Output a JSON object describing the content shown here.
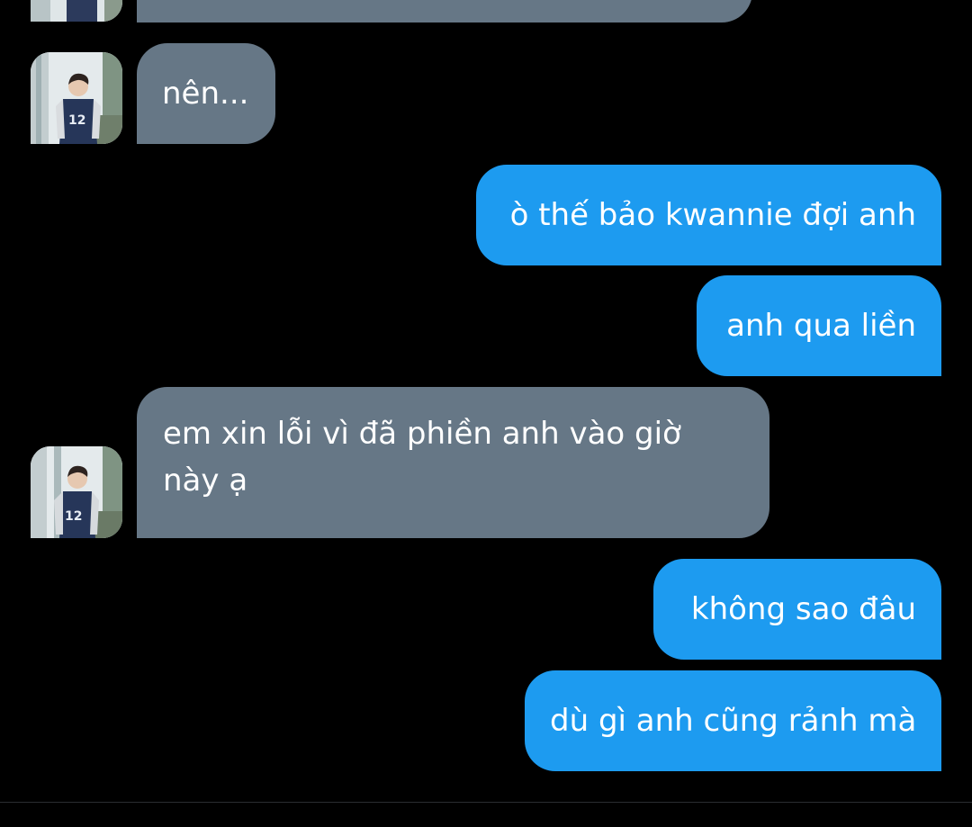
{
  "conversation": {
    "messages": [
      {
        "direction": "incoming",
        "text": ""
      },
      {
        "direction": "incoming",
        "text": "nên..."
      },
      {
        "direction": "outgoing",
        "text": "ò thế bảo kwannie đợi anh"
      },
      {
        "direction": "outgoing",
        "text": "anh qua liền"
      },
      {
        "direction": "incoming",
        "text": "em xin lỗi vì đã phiền anh vào giờ này ạ"
      },
      {
        "direction": "outgoing",
        "text": "không sao đâu"
      },
      {
        "direction": "outgoing",
        "text": "dù gì anh cũng rảnh mà"
      }
    ]
  },
  "colors": {
    "background": "#000000",
    "incoming_bubble": "#667786",
    "outgoing_bubble": "#1d9bf0",
    "text": "#ffffff"
  },
  "icons": {
    "avatar": "contact-avatar-photo"
  }
}
